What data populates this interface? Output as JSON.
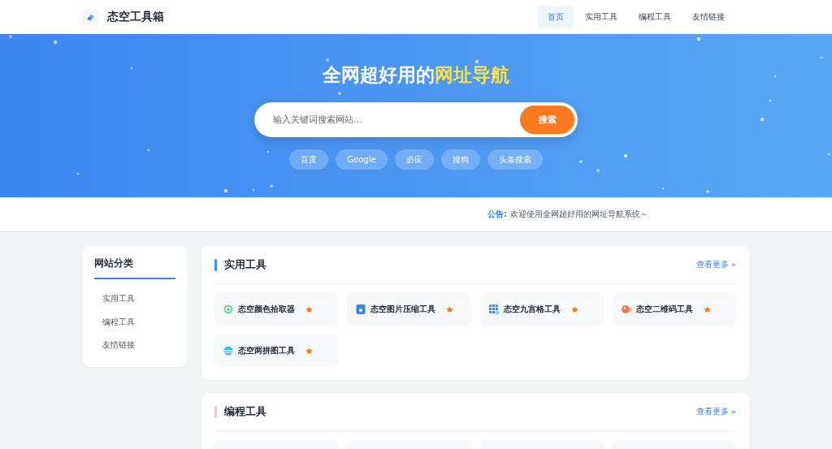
{
  "header": {
    "logo_text": "态空工具箱",
    "nav": [
      {
        "label": "首页",
        "selected": true
      },
      {
        "label": "实用工具",
        "selected": false
      },
      {
        "label": "编程工具",
        "selected": false
      },
      {
        "label": "友情链接",
        "selected": false
      }
    ]
  },
  "hero": {
    "title": "全网超好用的",
    "title_highlight": "网址导航",
    "search": {
      "placeholder": "输入关键词搜索网站...",
      "button": "搜索"
    },
    "engines": [
      {
        "label": "百度"
      },
      {
        "label": "Google"
      },
      {
        "label": "必应"
      },
      {
        "label": "搜狗"
      },
      {
        "label": "头条搜索"
      }
    ]
  },
  "notice": {
    "label": "公告:",
    "text": "欢迎使用全网超好用的网址导航系统～"
  },
  "sidebar": {
    "title": "网站分类",
    "items": [
      {
        "label": "实用工具"
      },
      {
        "label": "编程工具"
      },
      {
        "label": "友情链接"
      }
    ]
  },
  "sections": [
    {
      "title": "实用工具",
      "color": "#1e9bf0",
      "more": "查看更多 »",
      "tools": [
        {
          "kind": "tool",
          "name": "态空颜色拾取器",
          "starred": true
        },
        {
          "kind": "tool",
          "name": "态空图片压缩工具",
          "starred": true
        },
        {
          "kind": "tool",
          "name": "态空九宫格工具",
          "starred": true
        },
        {
          "kind": "tool",
          "name": "态空二维码工具",
          "starred": true
        },
        {
          "kind": "tool",
          "name": "态空两拼图工具",
          "starred": true
        }
      ]
    },
    {
      "title": "编程工具",
      "color": "#f4c7d0",
      "more": "查看更多 »",
      "tools": [
        {
          "kind": "blank"
        },
        {
          "kind": "blank"
        },
        {
          "kind": "blank"
        },
        {
          "kind": "blank"
        }
      ]
    }
  ]
}
